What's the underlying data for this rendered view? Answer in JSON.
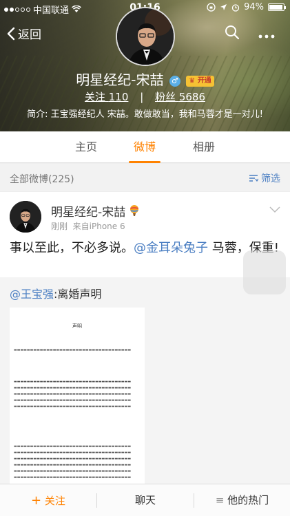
{
  "status_bar": {
    "carrier": "中国联通",
    "time": "01:16",
    "battery": "94%"
  },
  "header": {
    "back_label": "返回",
    "name": "明星经纪-宋喆",
    "gender_symbol": "♂",
    "vip_badge": "开通",
    "following_label": "关注",
    "following_count": "110",
    "followers_label": "粉丝",
    "followers_count": "5686",
    "intro": "简介: 王宝强经纪人 宋喆。敢做敢当，我和马蓉才是一对儿!"
  },
  "tabs": [
    {
      "label": "主页",
      "active": false
    },
    {
      "label": "微博",
      "active": true
    },
    {
      "label": "相册",
      "active": false
    }
  ],
  "filter_bar": {
    "all_label": "全部微博(225)",
    "filter_label": "筛选"
  },
  "post": {
    "author": "明星经纪-宋喆",
    "time": "刚刚",
    "source": "来自iPhone 6",
    "text_before": "事以至此，不必多说。",
    "mention": "@金耳朵兔子",
    "text_after": " 马蓉，保重!",
    "repost_mention": "@王宝强",
    "repost_text": ":离婚声明",
    "doc_title": "声明"
  },
  "bottom_bar": {
    "follow_label": "关注",
    "chat_label": "聊天",
    "hot_label": "他的热门"
  },
  "colors": {
    "accent": "#ff8200",
    "link": "#4a7ec2"
  }
}
